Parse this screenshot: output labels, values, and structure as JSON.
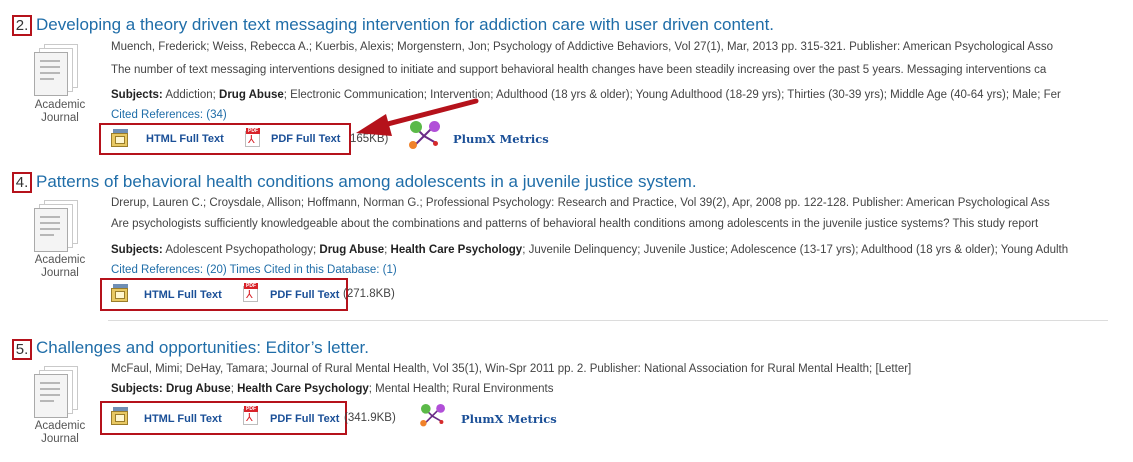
{
  "results": [
    {
      "number": "2.",
      "title": "Developing a theory driven text messaging intervention for addiction care with user driven content.",
      "byline": "Muench, Frederick; Weiss, Rebecca A.; Kuerbis, Alexis; Morgenstern, Jon; Psychology of Addictive Behaviors, Vol 27(1), Mar, 2013 pp. 315-321. Publisher: American Psychological Asso",
      "abstract": "The number of text messaging interventions designed to initiate and support behavioral health changes have been steadily increasing over the past 5 years. Messaging interventions ca",
      "subjects_label": "Subjects:",
      "subjects_pre": " Addiction; ",
      "subjects_bold": "Drug Abuse",
      "subjects_post": "; Electronic Communication; Intervention; Adulthood (18 yrs & older); Young Adulthood (18-29 yrs); Thirties (30-39 yrs); Middle Age (40-64 yrs); Male; Fer",
      "cited": "Cited References: (34)",
      "type_line1": "Academic",
      "type_line2": "Journal",
      "html_link": "HTML Full Text",
      "pdf_link": "PDF Full Text",
      "pdf_size": "165KB)",
      "plumx": "PlumX Metrics"
    },
    {
      "number": "4.",
      "title": "Patterns of behavioral health conditions among adolescents in a juvenile justice system.",
      "byline": "Drerup, Lauren C.; Croysdale, Allison; Hoffmann, Norman G.; Professional Psychology: Research and Practice, Vol 39(2), Apr, 2008 pp. 122-128. Publisher: American Psychological Ass",
      "abstract": "Are psychologists sufficiently knowledgeable about the combinations and patterns of behavioral health conditions among adolescents in the juvenile justice systems? This study report",
      "subjects_label": "Subjects:",
      "subjects_pre": " Adolescent Psychopathology; ",
      "subjects_bold": "Drug Abuse",
      "subjects_mid": "; ",
      "subjects_bold2": "Health Care Psychology",
      "subjects_post": "; Juvenile Delinquency; Juvenile Justice; Adolescence (13-17 yrs); Adulthood (18 yrs & older); Young Adulth",
      "cited": "Cited References: (20) Times Cited in this Database: (1)",
      "type_line1": "Academic",
      "type_line2": "Journal",
      "html_link": "HTML Full Text",
      "pdf_link": "PDF Full Text",
      "pdf_size": "(271.8KB)"
    },
    {
      "number": "5.",
      "title": "Challenges and opportunities: Editor’s letter.",
      "byline": "McFaul, Mimi; DeHay, Tamara; Journal of Rural Mental Health, Vol 35(1), Win-Spr 2011 pp. 2. Publisher: National Association for Rural Mental Health; [Letter]",
      "subjects_label": "Subjects:",
      "subjects_bold": " Drug Abuse",
      "subjects_mid": "; ",
      "subjects_bold2": "Health Care Psychology",
      "subjects_post": "; Mental Health; Rural Environments",
      "type_line1": "Academic",
      "type_line2": "Journal",
      "html_link": "HTML Full Text",
      "pdf_link": "PDF Full Text",
      "pdf_size": "(341.9KB)",
      "plumx": "PlumX Metrics"
    }
  ],
  "colors": {
    "link": "#1f6da8",
    "highlight": "#b5121b"
  },
  "icons": [
    "document-icon",
    "html-full-text-icon",
    "pdf-icon",
    "plumx-icon",
    "red-arrow"
  ]
}
